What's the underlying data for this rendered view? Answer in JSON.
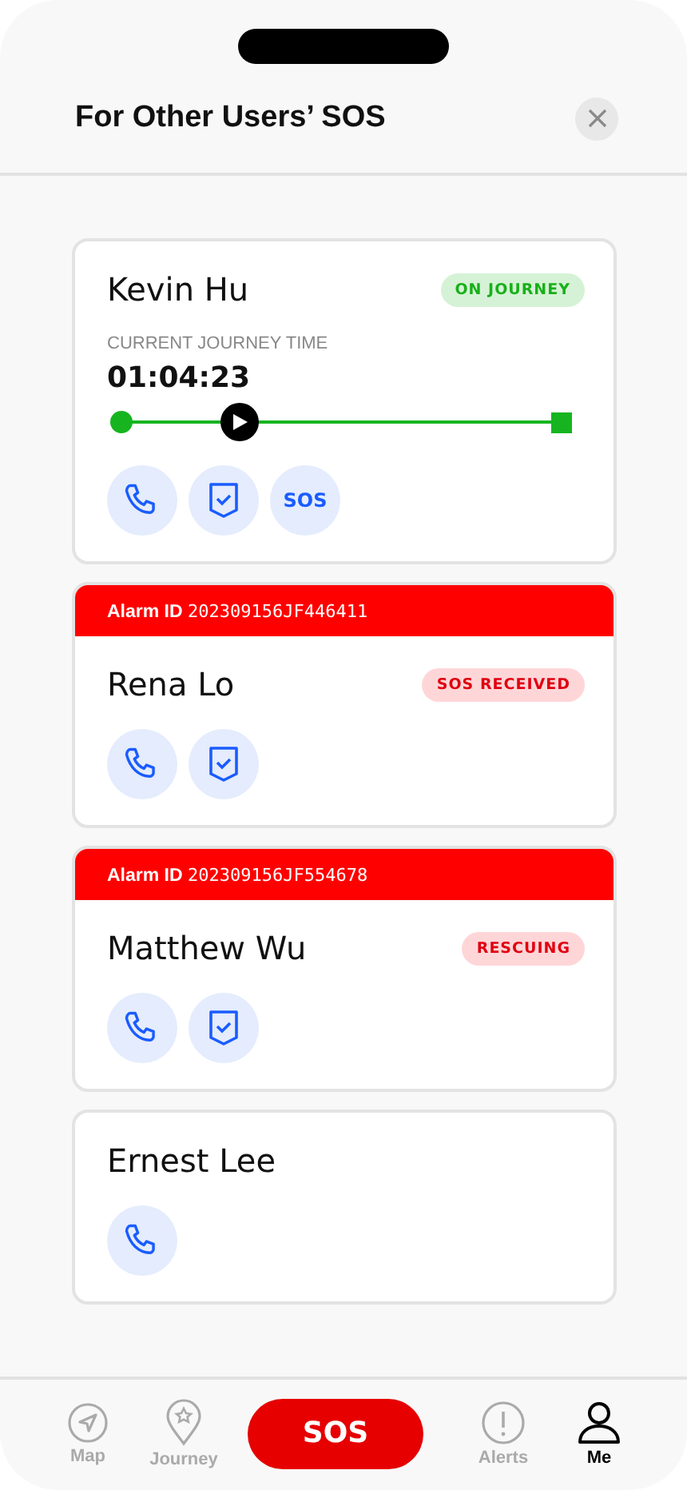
{
  "header": {
    "title": "For Other Users’ SOS"
  },
  "cards": [
    {
      "name": "Kevin Hu",
      "status": {
        "label": "ON JOURNEY",
        "kind": "journey"
      },
      "journey": {
        "label": "CURRENT JOURNEY TIME",
        "time": "01:04:23",
        "level": 0.28
      },
      "actions": [
        {
          "kind": "call"
        },
        {
          "kind": "shield"
        },
        {
          "kind": "sos",
          "label": "SOS"
        }
      ]
    },
    {
      "alarm": {
        "label": "Alarm ID",
        "id": "202309156JF446411"
      },
      "name": "Rena Lo",
      "status": {
        "label": "SOS RECEIVED",
        "kind": "alert"
      },
      "actions": [
        {
          "kind": "call"
        },
        {
          "kind": "shield"
        }
      ]
    },
    {
      "alarm": {
        "label": "Alarm ID",
        "id": "202309156JF554678"
      },
      "name": "Matthew Wu",
      "status": {
        "label": "RESCUING",
        "kind": "alert"
      },
      "actions": [
        {
          "kind": "call"
        },
        {
          "kind": "shield"
        }
      ]
    },
    {
      "name": "Ernest Lee",
      "actions": [
        {
          "kind": "call"
        }
      ]
    }
  ],
  "nav": [
    {
      "kind": "map",
      "label": "Map",
      "selected": false
    },
    {
      "kind": "journey",
      "label": "Journey",
      "selected": false
    },
    {
      "kind": "sos",
      "label": "SOS",
      "selected": false
    },
    {
      "kind": "alerts",
      "label": "Alerts",
      "selected": false
    },
    {
      "kind": "me",
      "label": "Me",
      "selected": true
    }
  ]
}
